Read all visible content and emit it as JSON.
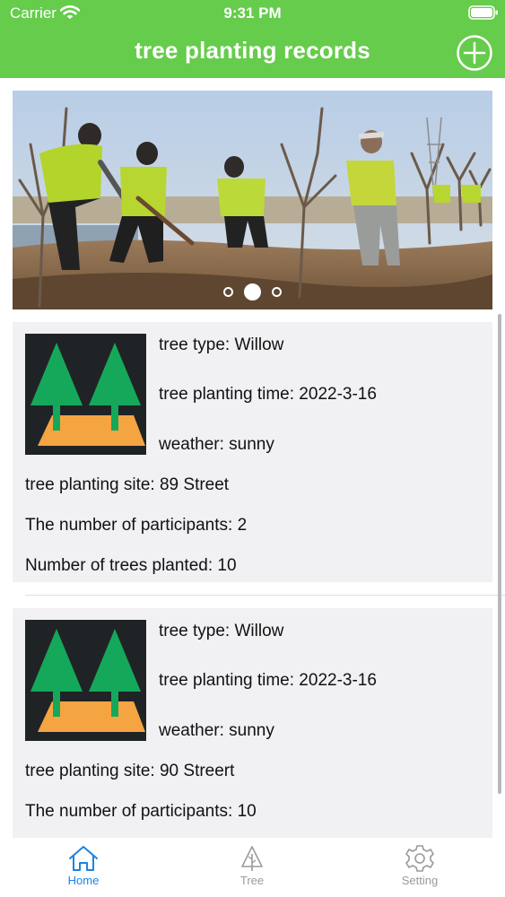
{
  "status_bar": {
    "carrier": "Carrier",
    "time": "9:31 PM"
  },
  "nav": {
    "title": "tree planting records",
    "add_icon": "plus-circle-icon"
  },
  "banner": {
    "image": "photo of volunteers in yellow safety vests planting trees",
    "page_count": 3,
    "current_page": 2
  },
  "records": [
    {
      "thumbnail": "two-trees-icon",
      "tree_type": "tree type: Willow",
      "planting_time": "tree planting time:  2022-3-16",
      "weather": "weather: sunny",
      "site": "tree planting site:  89 Street",
      "participants": "The number of participants:  2",
      "trees_planted": "Number of trees planted:  10"
    },
    {
      "thumbnail": "two-trees-icon",
      "tree_type": "tree type: Willow",
      "planting_time": "tree planting time:  2022-3-16",
      "weather": "weather: sunny",
      "site": "tree planting site:  90 Streert",
      "participants": "The number of participants:  10"
    }
  ],
  "tabs": [
    {
      "label": "Home",
      "icon": "home-icon",
      "selected": true
    },
    {
      "label": "Tree",
      "icon": "tree-icon",
      "selected": false
    },
    {
      "label": "Setting",
      "icon": "gear-icon",
      "selected": false
    }
  ],
  "colors": {
    "header_green": "#66cc4c",
    "tab_selected": "#1a82e6",
    "tab_unselected": "#9a9a9a",
    "card_background": "#f1f1f4",
    "thumbnail_background": "#202326",
    "tree_green": "#15a85a",
    "ground_orange": "#f5a442"
  }
}
